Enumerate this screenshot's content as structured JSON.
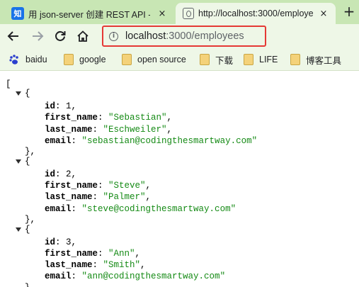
{
  "tabs": [
    {
      "favicon": "zhihu-icon",
      "favicon_text": "知",
      "title": "用 json-server 创建 REST API -",
      "close": "×"
    },
    {
      "favicon": "page-icon",
      "title": "http://localhost:3000/employe",
      "close": "×"
    }
  ],
  "new_tab_symbol": "+",
  "address": {
    "host": "localhost",
    "path": ":3000/employees",
    "info_symbol": "i"
  },
  "bookmarks": [
    {
      "label": "baidu",
      "icon": "baidu-paw-icon"
    },
    {
      "label": "google",
      "icon": "folder-icon"
    },
    {
      "label": "open source",
      "icon": "folder-icon"
    },
    {
      "label": "下载",
      "icon": "folder-icon"
    },
    {
      "label": "LIFE",
      "icon": "folder-icon"
    },
    {
      "label": "博客工具",
      "icon": "folder-icon"
    }
  ],
  "json_view": {
    "open_bracket": "[",
    "open_brace": "{",
    "close_brace_comma": "},",
    "close_brace": "}",
    "keys": {
      "id": "id",
      "first_name": "first_name",
      "last_name": "last_name",
      "email": "email"
    },
    "employees": [
      {
        "id": "1",
        "first_name": "\"Sebastian\"",
        "last_name": "\"Eschweiler\"",
        "email": "\"sebastian@codingthesmartway.com\""
      },
      {
        "id": "2",
        "first_name": "\"Steve\"",
        "last_name": "\"Palmer\"",
        "email": "\"steve@codingthesmartway.com\""
      },
      {
        "id": "3",
        "first_name": "\"Ann\"",
        "last_name": "\"Smith\"",
        "email": "\"ann@codingthesmartway.com\""
      }
    ]
  }
}
